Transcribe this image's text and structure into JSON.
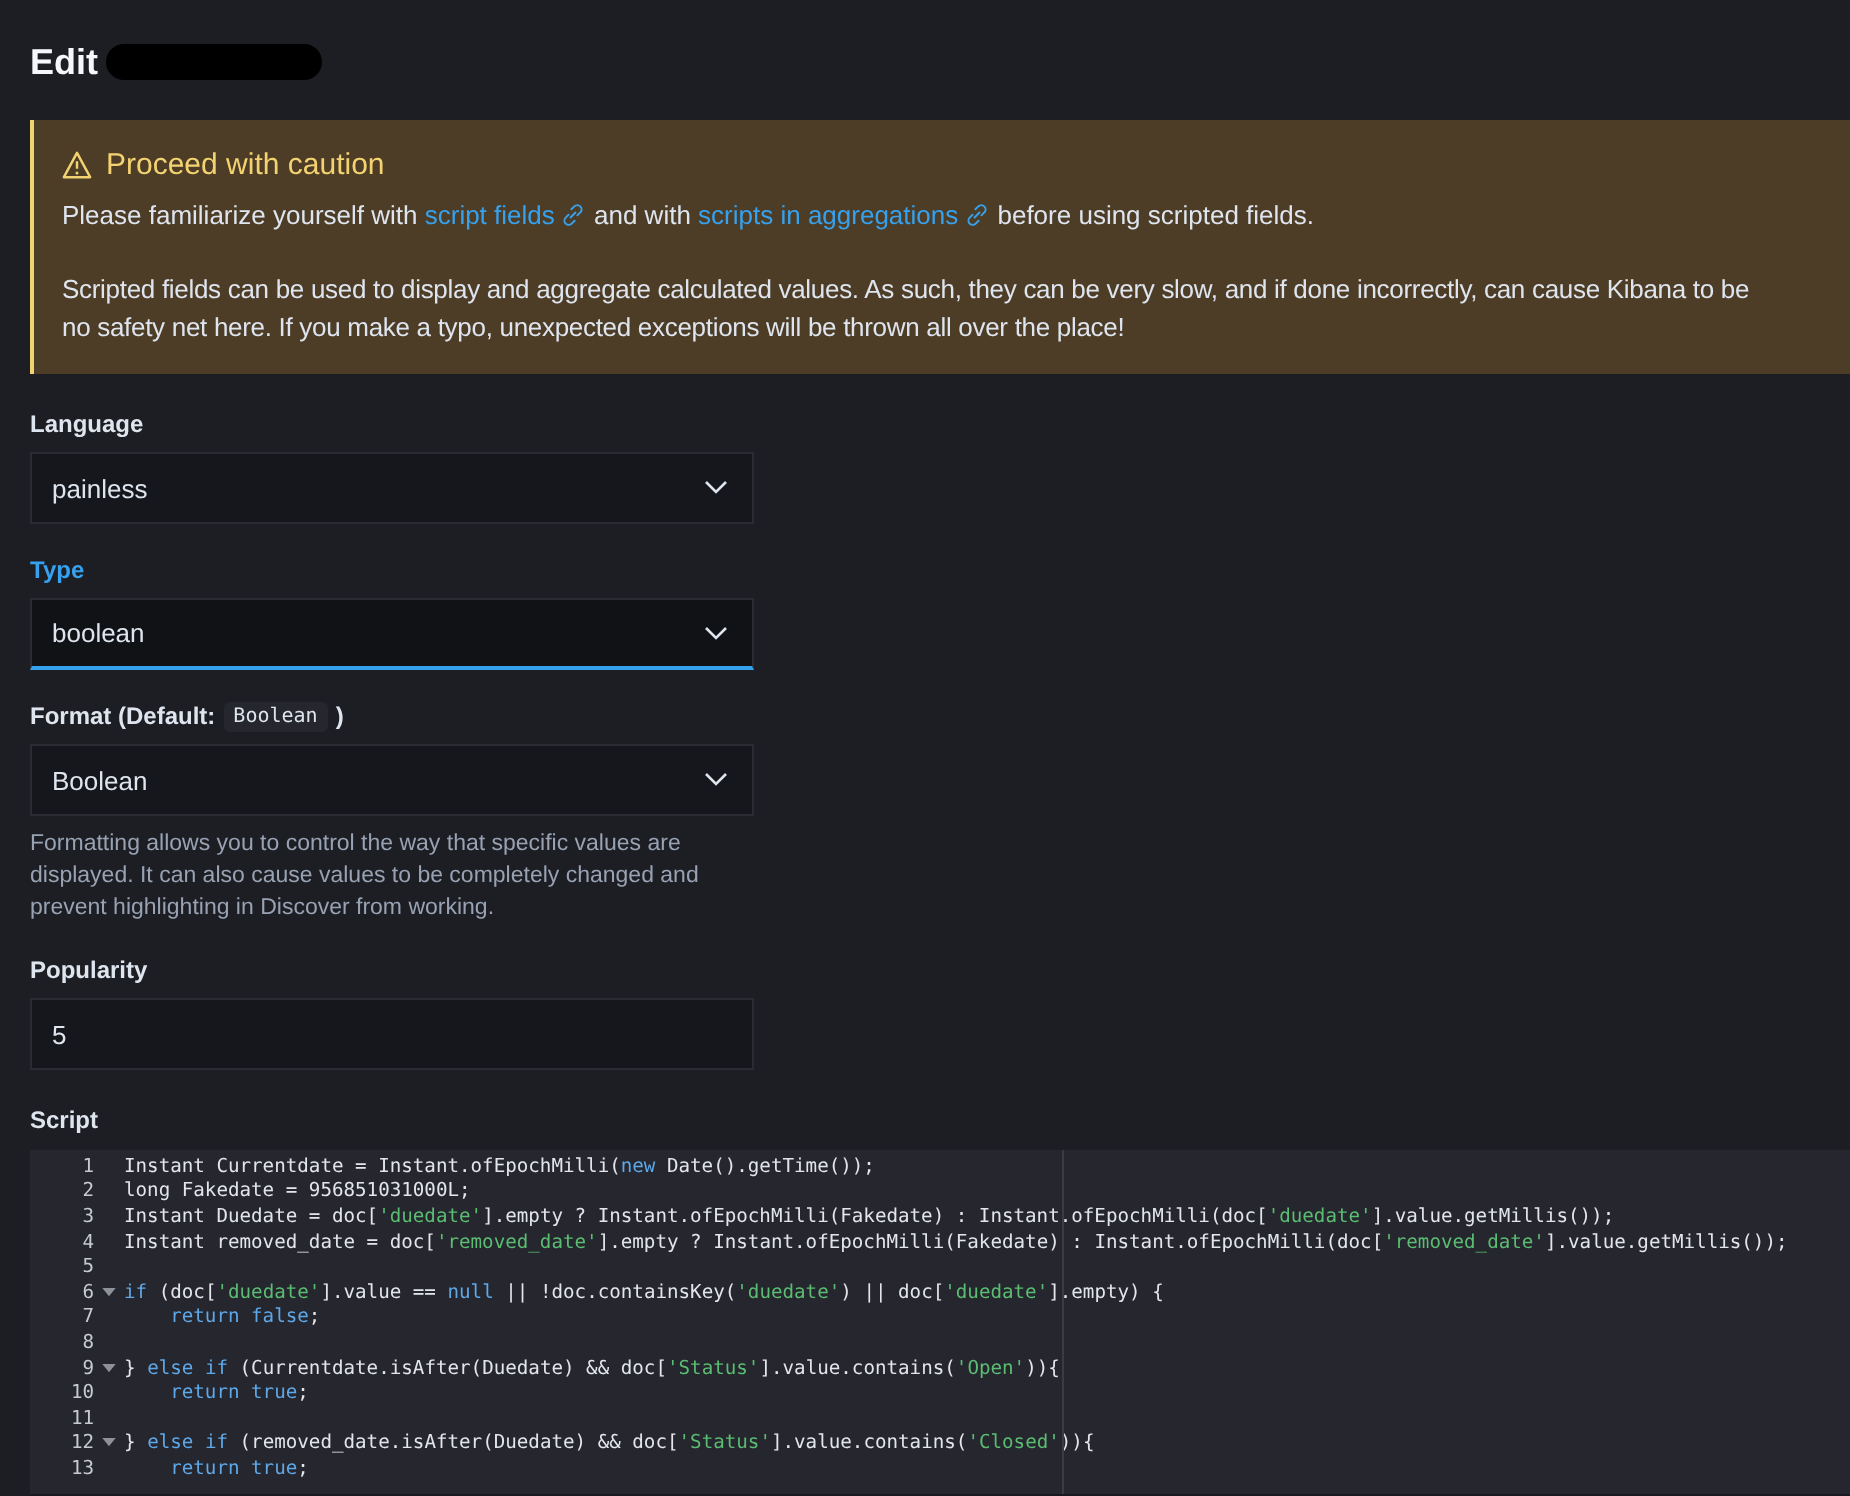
{
  "page": {
    "title": "Edit"
  },
  "callout": {
    "title": "Proceed with caution",
    "intro": [
      {
        "kind": "text",
        "text": "Please familiarize yourself with "
      },
      {
        "kind": "link",
        "text": "script fields"
      },
      {
        "kind": "text",
        "text": " and with "
      },
      {
        "kind": "link",
        "text": "scripts in aggregations"
      },
      {
        "kind": "text",
        "text": " before using scripted fields."
      }
    ],
    "body_lines": [
      "Scripted fields can be used to display and aggregate calculated values. As such, they can be very slow, and if done incorrectly, can cause Kibana to be",
      "no safety net here. If you make a typo, unexpected exceptions will be thrown all over the place!"
    ]
  },
  "fields": [
    {
      "kind": "select",
      "label": "Language",
      "value": "painless",
      "focused": false
    },
    {
      "kind": "select",
      "label": "Type",
      "value": "boolean",
      "focused": true
    },
    {
      "kind": "select",
      "label": "Format (Default: ",
      "label_code": "Boolean",
      "label_end": ")",
      "value": "Boolean",
      "focused": false,
      "help": "Formatting allows you to control the way that specific values are displayed. It can also cause values to be completely changed and prevent highlighting in Discover from working."
    },
    {
      "kind": "number",
      "label": "Popularity",
      "value": "5",
      "focused": false
    }
  ],
  "script": {
    "label": "Script",
    "lines": [
      {
        "number": "1",
        "fold": false,
        "tokens": [
          {
            "kind": "plain",
            "text": "Instant Currentdate = Instant.ofEpochMilli("
          },
          {
            "kind": "keyword",
            "text": "new"
          },
          {
            "kind": "plain",
            "text": " Date().getTime());"
          }
        ]
      },
      {
        "number": "2",
        "fold": false,
        "tokens": [
          {
            "kind": "plain",
            "text": "long Fakedate = 956851031000L;"
          }
        ]
      },
      {
        "number": "3",
        "fold": false,
        "tokens": [
          {
            "kind": "plain",
            "text": "Instant Duedate = doc["
          },
          {
            "kind": "string",
            "text": "'duedate'"
          },
          {
            "kind": "plain",
            "text": "].empty ? Instant.ofEpochMilli(Fakedate) : Instant.ofEpochMilli(doc["
          },
          {
            "kind": "string",
            "text": "'duedate'"
          },
          {
            "kind": "plain",
            "text": "].value.getMillis());"
          }
        ]
      },
      {
        "number": "4",
        "fold": false,
        "tokens": [
          {
            "kind": "plain",
            "text": "Instant removed_date = doc["
          },
          {
            "kind": "string",
            "text": "'removed_date'"
          },
          {
            "kind": "plain",
            "text": "].empty ? Instant.ofEpochMilli(Fakedate) : Instant.ofEpochMilli(doc["
          },
          {
            "kind": "string",
            "text": "'removed_date'"
          },
          {
            "kind": "plain",
            "text": "].value.getMillis());"
          }
        ]
      },
      {
        "number": "5",
        "fold": false
      },
      {
        "number": "6",
        "fold": true,
        "tokens": [
          {
            "kind": "keyword",
            "text": "if"
          },
          {
            "kind": "plain",
            "text": " (doc["
          },
          {
            "kind": "string",
            "text": "'duedate'"
          },
          {
            "kind": "plain",
            "text": "].value == "
          },
          {
            "kind": "keyword",
            "text": "null"
          },
          {
            "kind": "plain",
            "text": " || !doc.containsKey("
          },
          {
            "kind": "string",
            "text": "'duedate'"
          },
          {
            "kind": "plain",
            "text": ") || doc["
          },
          {
            "kind": "string",
            "text": "'duedate'"
          },
          {
            "kind": "plain",
            "text": "].empty) {"
          }
        ]
      },
      {
        "number": "7",
        "fold": false,
        "indented": true,
        "tokens": [
          {
            "kind": "keyword",
            "text": "return false"
          },
          {
            "kind": "plain",
            "text": ";"
          }
        ]
      },
      {
        "number": "8",
        "fold": false
      },
      {
        "number": "9",
        "fold": true,
        "tokens": [
          {
            "kind": "plain",
            "text": "} "
          },
          {
            "kind": "keyword",
            "text": "else if"
          },
          {
            "kind": "plain",
            "text": " (Currentdate.isAfter(Duedate) && doc["
          },
          {
            "kind": "string",
            "text": "'Status'"
          },
          {
            "kind": "plain",
            "text": "].value.contains("
          },
          {
            "kind": "string",
            "text": "'Open'"
          },
          {
            "kind": "plain",
            "text": ")){"
          }
        ]
      },
      {
        "number": "10",
        "fold": false,
        "indented": true,
        "tokens": [
          {
            "kind": "keyword",
            "text": "return true"
          },
          {
            "kind": "plain",
            "text": ";"
          }
        ]
      },
      {
        "number": "11",
        "fold": false
      },
      {
        "number": "12",
        "fold": true,
        "tokens": [
          {
            "kind": "plain",
            "text": "} "
          },
          {
            "kind": "keyword",
            "text": "else if"
          },
          {
            "kind": "plain",
            "text": " (removed_date.isAfter(Duedate) && doc["
          },
          {
            "kind": "string",
            "text": "'Status'"
          },
          {
            "kind": "plain",
            "text": "].value.contains("
          },
          {
            "kind": "string",
            "text": "'Closed'"
          },
          {
            "kind": "plain",
            "text": ")){"
          }
        ]
      },
      {
        "number": "13",
        "fold": false,
        "indented": true,
        "tokens": [
          {
            "kind": "keyword",
            "text": "return true"
          },
          {
            "kind": "plain",
            "text": ";"
          }
        ]
      }
    ]
  }
}
